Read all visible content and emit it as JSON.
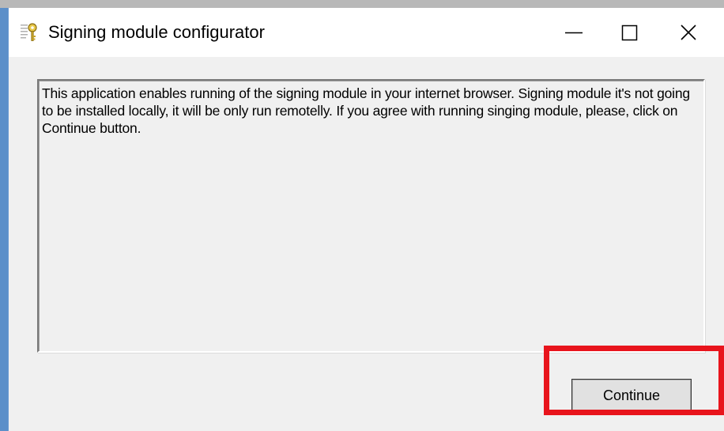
{
  "window": {
    "title": "Signing module configurator",
    "icon": "key-certificate-icon"
  },
  "controls": {
    "minimize_icon": "minimize-icon",
    "maximize_icon": "maximize-icon",
    "close_icon": "close-icon"
  },
  "message": {
    "text": "This application enables running of the signing module in your internet browser. Signing module it's not going to be installed locally, it will be only run remotelly. If you agree with running singing module, please, click on Continue button."
  },
  "buttons": {
    "continue_label": "Continue"
  },
  "annotation": {
    "highlight_color": "#e8141c"
  }
}
